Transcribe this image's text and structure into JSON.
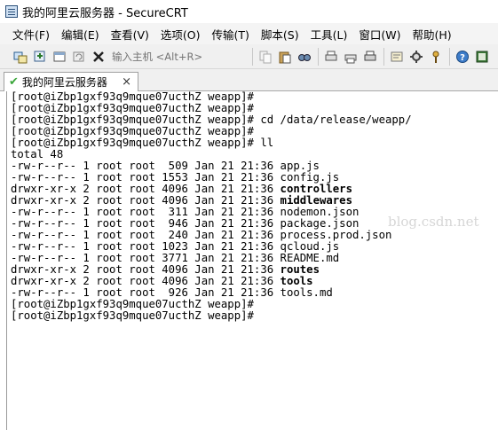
{
  "window": {
    "title": "我的阿里云服务器 - SecureCRT",
    "icon": "securecrt-app-icon"
  },
  "menu": [
    "文件(F)",
    "编辑(E)",
    "查看(V)",
    "选项(O)",
    "传输(T)",
    "脚本(S)",
    "工具(L)",
    "窗口(W)",
    "帮助(H)"
  ],
  "toolbar": {
    "host_placeholder": "输入主机 <Alt+R>"
  },
  "tab": {
    "label": "我的阿里云服务器",
    "close": "×",
    "status_icon": "check-icon"
  },
  "terminal": {
    "lines": [
      "[root@iZbp1gxf93q9mque07ucthZ weapp]#",
      "[root@iZbp1gxf93q9mque07ucthZ weapp]#",
      "[root@iZbp1gxf93q9mque07ucthZ weapp]# cd /data/release/weapp/",
      "[root@iZbp1gxf93q9mque07ucthZ weapp]#",
      "[root@iZbp1gxf93q9mque07ucthZ weapp]# ll",
      "total 48",
      "-rw-r--r-- 1 root root  509 Jan 21 21:36 app.js",
      "-rw-r--r-- 1 root root 1553 Jan 21 21:36 config.js",
      "drwxr-xr-x 2 root root 4096 Jan 21 21:36 controllers",
      "drwxr-xr-x 2 root root 4096 Jan 21 21:36 middlewares",
      "-rw-r--r-- 1 root root  311 Jan 21 21:36 nodemon.json",
      "-rw-r--r-- 1 root root  946 Jan 21 21:36 package.json",
      "-rw-r--r-- 1 root root  240 Jan 21 21:36 process.prod.json",
      "-rw-r--r-- 1 root root 1023 Jan 21 21:36 qcloud.js",
      "-rw-r--r-- 1 root root 3771 Jan 21 21:36 README.md",
      "drwxr-xr-x 2 root root 4096 Jan 21 21:36 routes",
      "drwxr-xr-x 2 root root 4096 Jan 21 21:36 tools",
      "-rw-r--r-- 1 root root  926 Jan 21 21:36 tools.md",
      "[root@iZbp1gxf93q9mque07ucthZ weapp]#",
      "[root@iZbp1gxf93q9mque07ucthZ weapp]#"
    ],
    "bold_lines": [
      8,
      9,
      15,
      16
    ]
  },
  "watermark": "blog.csdn.net"
}
